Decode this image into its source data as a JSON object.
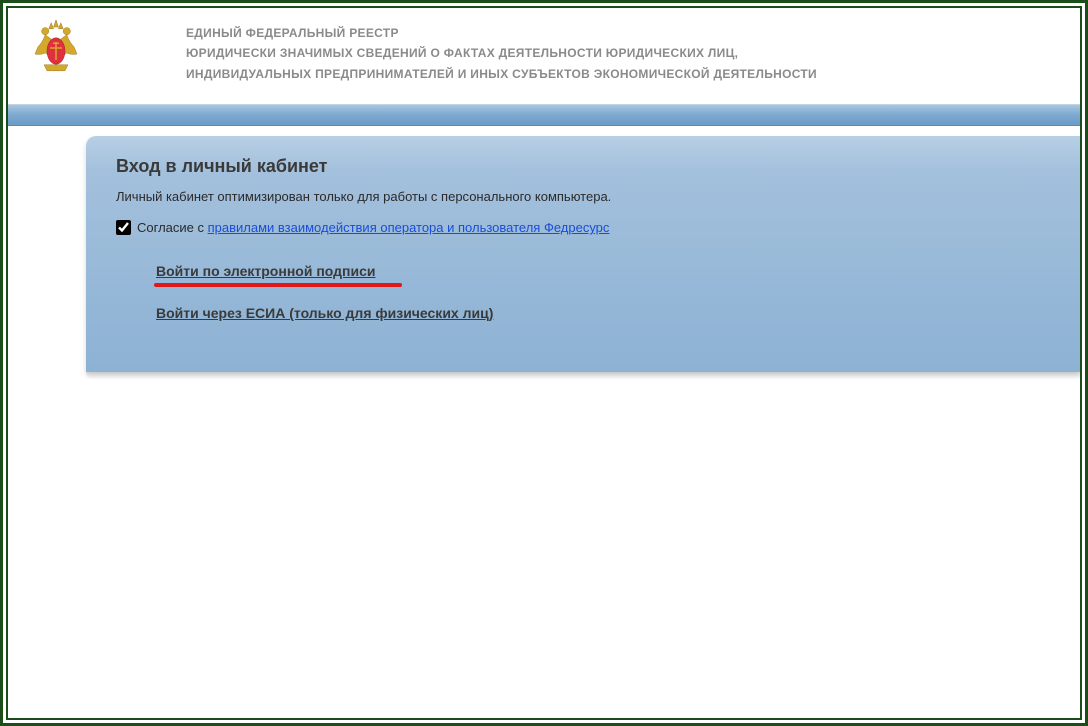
{
  "header": {
    "line1": "ЕДИНЫЙ ФЕДЕРАЛЬНЫЙ РЕЕСТР",
    "line2": "ЮРИДИЧЕСКИ ЗНАЧИМЫХ СВЕДЕНИЙ О ФАКТАХ ДЕЯТЕЛЬНОСТИ ЮРИДИЧЕСКИХ ЛИЦ,",
    "line3": "ИНДИВИДУАЛЬНЫХ ПРЕДПРИНИМАТЕЛЕЙ И ИНЫХ СУБЪЕКТОВ ЭКОНОМИЧЕСКОЙ ДЕЯТЕЛЬНОСТИ"
  },
  "login": {
    "title": "Вход в личный кабинет",
    "subtitle": "Личный кабинет оптимизирован только для работы с персонального компьютера.",
    "consent_prefix": "Согласие с ",
    "consent_link": "правилами взаимодействия оператора и пользователя Федресурс",
    "option1": "Войти по электронной подписи",
    "option2": "Войти через ЕСИА (только для физических лиц)"
  }
}
